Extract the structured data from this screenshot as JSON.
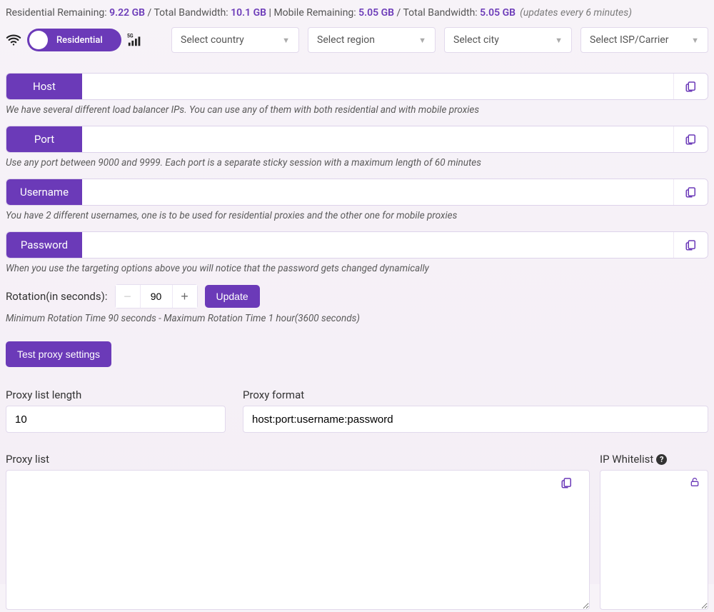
{
  "topbar": {
    "res_label": "Residential Remaining: ",
    "res_remaining": "9.22 GB",
    "total_sep": " / Total Bandwidth: ",
    "res_total": "10.1 GB",
    "sep": "   |   ",
    "mob_label": "Mobile Remaining: ",
    "mob_remaining": "5.05 GB",
    "mob_total": "5.05 GB",
    "updates": "(updates every 6 minutes)"
  },
  "toggle": {
    "label": "Residential"
  },
  "selects": {
    "country": "Select country",
    "region": "Select region",
    "city": "Select city",
    "isp": "Select ISP/Carrier"
  },
  "fields": {
    "host": {
      "label": "Host",
      "value": "",
      "hint": "We have several different load balancer IPs. You can use any of them with both residential and with mobile proxies"
    },
    "port": {
      "label": "Port",
      "value": "",
      "hint": "Use any port between 9000 and 9999. Each port is a separate sticky session with a maximum length of 60 minutes"
    },
    "username": {
      "label": "Username",
      "value": "",
      "hint": "You have 2 different usernames, one is to be used for residential proxies and the other one for mobile proxies"
    },
    "password": {
      "label": "Password",
      "value": "",
      "hint": "When you use the targeting options above you will notice that the password gets changed dynamically"
    }
  },
  "rotation": {
    "label": "Rotation(in seconds):",
    "value": "90",
    "update": "Update",
    "hint": "Minimum Rotation Time 90 seconds - Maximum Rotation Time 1 hour(3600 seconds)"
  },
  "test_btn": "Test proxy settings",
  "proxy_list_length": {
    "label": "Proxy list length",
    "value": "10"
  },
  "proxy_format": {
    "label": "Proxy format",
    "value": "host:port:username:password"
  },
  "proxy_list": {
    "label": "Proxy list",
    "value": ""
  },
  "ip_whitelist": {
    "label": "IP Whitelist",
    "value": ""
  }
}
